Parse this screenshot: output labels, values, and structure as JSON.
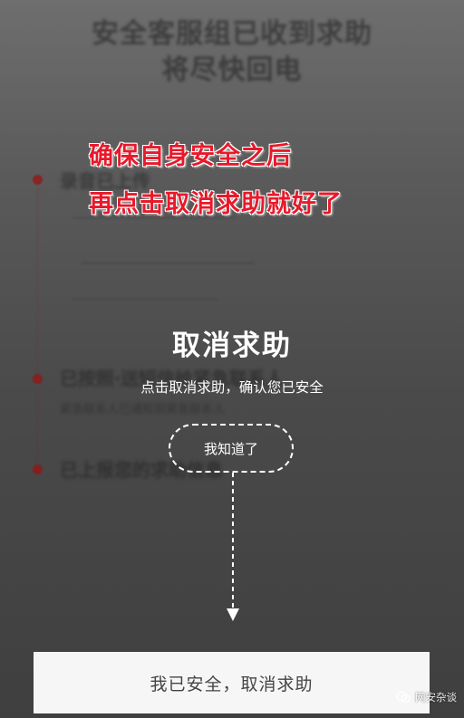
{
  "background": {
    "title_lines": [
      "安全客服组已收到求助",
      "将尽快回电"
    ],
    "items": [
      {
        "label": "录音已上传",
        "sub": ""
      },
      {
        "label": "已按照‧送短信给紧急联系人",
        "sub": "紧急联系人已通知到紧急联系人"
      },
      {
        "label": "已上报您的求助信息",
        "sub": ""
      }
    ]
  },
  "annotation": {
    "line1": "确保自身安全之后",
    "line2": "再点击取消求助就好了"
  },
  "modal": {
    "title": "取消求助",
    "description": "点击取消求助，确认您已安全",
    "ack_button": "我知道了"
  },
  "bottom_button": {
    "label": "我已安全，取消求助"
  },
  "watermark": {
    "text": "网安杂谈",
    "icon": "wechat-icon"
  },
  "colors": {
    "annotation": "#e8192a",
    "overlay": "#4a4a4a",
    "button_bg": "#f6f6f6"
  }
}
